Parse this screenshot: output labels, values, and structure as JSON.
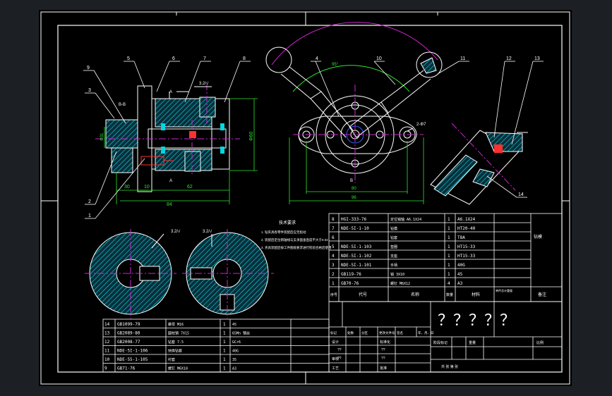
{
  "colors": {
    "background": "#000000",
    "frame": "#ffffff",
    "outline": "#ffffff",
    "dimension": "#2ee62e",
    "centerline": "#d024d0",
    "hatch": "#00d8e0",
    "leader": "#ffffff",
    "accent_blue": "#2f5cff",
    "accent_red": "#ff3030"
  },
  "callouts": [
    "1",
    "2",
    "3",
    "4",
    "5",
    "6",
    "7",
    "8",
    "9",
    "10",
    "11",
    "12",
    "13",
    "14"
  ],
  "section_marks": {
    "b_top": "B-B",
    "a_top": "A",
    "a_bottom": "A",
    "b_bottom": "B"
  },
  "roughness": {
    "r1": "3.2/√",
    "r2": "3.2/√",
    "r3": "3.2/√",
    "r4": "√√/"
  },
  "dims": {
    "d_30": "30",
    "d_10": "10",
    "d_62": "62",
    "d_84": "84",
    "d_80_v": "Φ80",
    "d_60_v": "Φ60",
    "d_31_v": "Φ31",
    "d_80": "80",
    "d_96": "96",
    "d_angle": "95°",
    "d_hole": "2-Φ7"
  },
  "tech_notes": {
    "title": "技术要求",
    "lines": [
      "1. 钻夹具各零件装配后应无松动",
      "2. 装配后定位销轴线与支承面垂直度不大于0.02",
      "3. 夹具装配后按工件图纸要求进行检验合格后使用"
    ]
  },
  "bom_right": [
    {
      "no": "8",
      "code": "HGI-333-76",
      "name": "定位销轴 A6.1X24",
      "qty": "1",
      "material": "A6.1X24"
    },
    {
      "no": "7",
      "code": "NDE-5I-1-10",
      "name": "钻模",
      "qty": "1",
      "material": "HT20-40"
    },
    {
      "no": "6",
      "code": "",
      "name": "钻套",
      "qty": "1",
      "material": "T8A"
    },
    {
      "no": "5",
      "code": "NDE-5I-1-103",
      "name": "垫圈",
      "qty": "1",
      "material": "HT15-33"
    },
    {
      "no": "4",
      "code": "NDE-5I-1-102",
      "name": "支座",
      "qty": "1",
      "material": "HT15-33"
    },
    {
      "no": "3",
      "code": "NDE-5I-1-101",
      "name": "手柄",
      "qty": "1",
      "material": "40G"
    },
    {
      "no": "2",
      "code": "GB119-76",
      "name": "销 3X10",
      "qty": "1",
      "material": "45"
    },
    {
      "no": "1",
      "code": "GB70-76",
      "name": "螺钉 M6X12",
      "qty": "4",
      "material": "A3"
    }
  ],
  "bom_right_header": {
    "no": "序号",
    "code": "代号",
    "name": "名称",
    "qty": "数量",
    "material": "材料",
    "weight": "单件总计重量",
    "note": "备注"
  },
  "bom_right_extra": {
    "row7_note": "钻模",
    "ratio_label": "比例",
    "ratio": "1:2"
  },
  "title_block": {
    "title": "？？？？？",
    "headers": [
      "标记",
      "处数",
      "分区",
      "更改文件号",
      "签名",
      "年、月、日"
    ],
    "rows": [
      "设计",
      "审核",
      "工艺"
    ],
    "std": "标准化",
    "approve": "批准",
    "stage_headers": [
      "阶段标记",
      "重量",
      "比例"
    ],
    "sheet": "共  张  第  张",
    "placeholders": [
      "??",
      "??",
      "??",
      "??"
    ]
  },
  "bom_left": [
    {
      "no": "14",
      "code": "GB1099-79",
      "name": "螺母 M16",
      "qty": "1",
      "material": "45"
    },
    {
      "no": "13",
      "code": "GB2089-80",
      "name": "圆柱销 7X15",
      "qty": "1",
      "material": "65Mn 钢丝"
    },
    {
      "no": "12",
      "code": "GB2008-77",
      "name": "钻套 7.5",
      "qty": "1",
      "material": "GCr6"
    },
    {
      "no": "11",
      "code": "NDE-5I-1-106",
      "name": "快换钻套",
      "qty": "1",
      "material": "40G"
    },
    {
      "no": "10",
      "code": "NDE-55-1-105",
      "name": "衬套",
      "qty": "1",
      "material": "35"
    },
    {
      "no": "9",
      "code": "GB71-76",
      "name": "螺钉 M6X10",
      "qty": "1",
      "material": "A3"
    }
  ]
}
